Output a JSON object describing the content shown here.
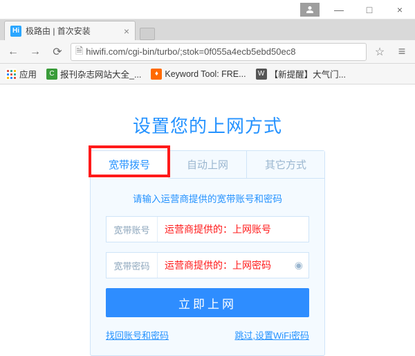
{
  "window": {
    "minimize": "—",
    "maximize": "□",
    "close": "×"
  },
  "browser": {
    "tab_title": "极路由 | 首次安装",
    "favicon_text": "Hi",
    "address": "hiwifi.com/cgi-bin/turbo/;stok=0f055a4ecb5ebd50ec8",
    "apps_label": "应用",
    "bookmarks": [
      {
        "label": "报刊杂志网站大全_...",
        "icon": "green",
        "glyph": "C"
      },
      {
        "label": "Keyword Tool: FRE...",
        "icon": "orange",
        "glyph": "♦"
      },
      {
        "label": "【新提醒】大气门...",
        "icon": "wp",
        "glyph": "W"
      }
    ]
  },
  "content": {
    "title": "设置您的上网方式",
    "tabs": [
      {
        "label": "宽带拨号",
        "active": true
      },
      {
        "label": "自动上网",
        "active": false
      },
      {
        "label": "其它方式",
        "active": false
      }
    ],
    "hint": "请输入运营商提供的宽带账号和密码",
    "fields": {
      "account_label": "宽带账号",
      "account_placeholder": "运营商提供的：上网账号",
      "password_label": "宽带密码",
      "password_placeholder": "运营商提供的：上网密码"
    },
    "submit": "立即上网",
    "link_left": "找回账号和密码",
    "link_right": "跳过,设置WiFi密码"
  }
}
